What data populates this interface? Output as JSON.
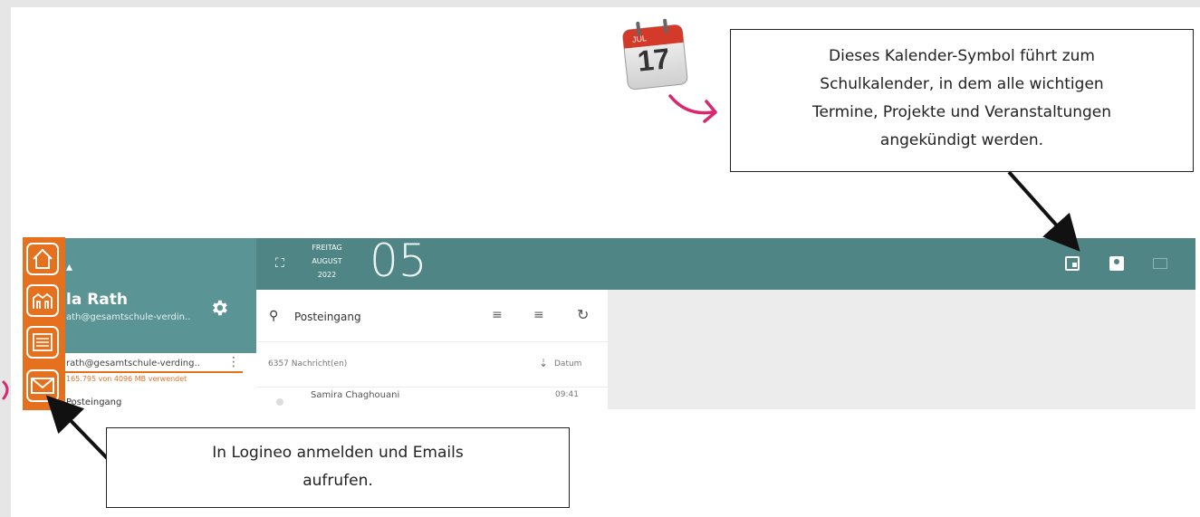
{
  "callout_top": {
    "line1": "Dieses Kalender-Symbol führt zum",
    "line2": "Schulkalender, in dem alle wichtigen",
    "line3": "Termine, Projekte und Veranstaltungen",
    "line4": "angekündigt werden."
  },
  "callout_bottom": {
    "line1": "In Logineo anmelden und Emails",
    "line2": "aufrufen."
  },
  "calendar_badge": {
    "month": "JUL",
    "day": "17"
  },
  "header": {
    "weekday": "FREITAG",
    "month": "AUGUST",
    "year": "2022",
    "day": "05"
  },
  "profile": {
    "name": "la Rath",
    "email": "ath@gesamtschule-verdin..",
    "account": "rath@gesamtschule-verding..",
    "quota": "165.795 von 4096 MB verwendet",
    "folder": "Posteingang"
  },
  "list": {
    "search_placeholder": "Posteingang",
    "count": "6357 Nachricht(en)",
    "sort_label": "Datum",
    "first_sender": "Samira Chaghouani",
    "first_time": "09:41"
  },
  "colors": {
    "teal": "#4f8585",
    "orange": "#e5711f",
    "arrow_pink": "#d8286f"
  }
}
